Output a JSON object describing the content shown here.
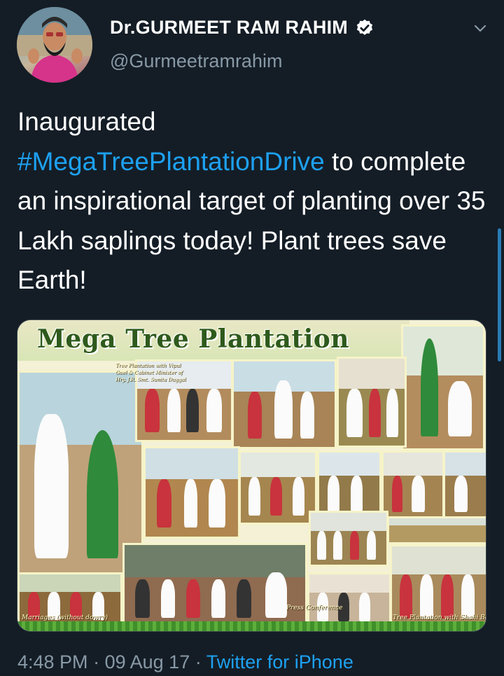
{
  "user": {
    "display_name": "Dr.GURMEET RAM RAHIM",
    "handle": "@Gurmeetramrahim",
    "verified_icon": "verified-badge-icon",
    "menu_icon": "chevron-down-icon"
  },
  "tweet": {
    "text_before": "Inaugurated",
    "hashtag": "#MegaTreePlantationDrive",
    "text_after": " to complete an inspirational target of planting over 35 Lakh saplings today! Plant trees save Earth!"
  },
  "media": {
    "title": "Mega Tree Plantation",
    "captions": {
      "top": "Tree Plantation with Vipul Goel & Cabinet Minister of Hry. J.R. Smt. Sunita Duggal",
      "marriages": "Marriages (without dowry)",
      "press": "Press Conference",
      "shahi": "Tree Plantation with Shahi Beti yaan"
    }
  },
  "meta": {
    "time": "4:48 PM",
    "separator": "·",
    "date": "09 Aug 17",
    "source": "Twitter for iPhone"
  },
  "colors": {
    "background": "#141d26",
    "text": "#ffffff",
    "secondary": "#8899a6",
    "link": "#1da1f2"
  }
}
